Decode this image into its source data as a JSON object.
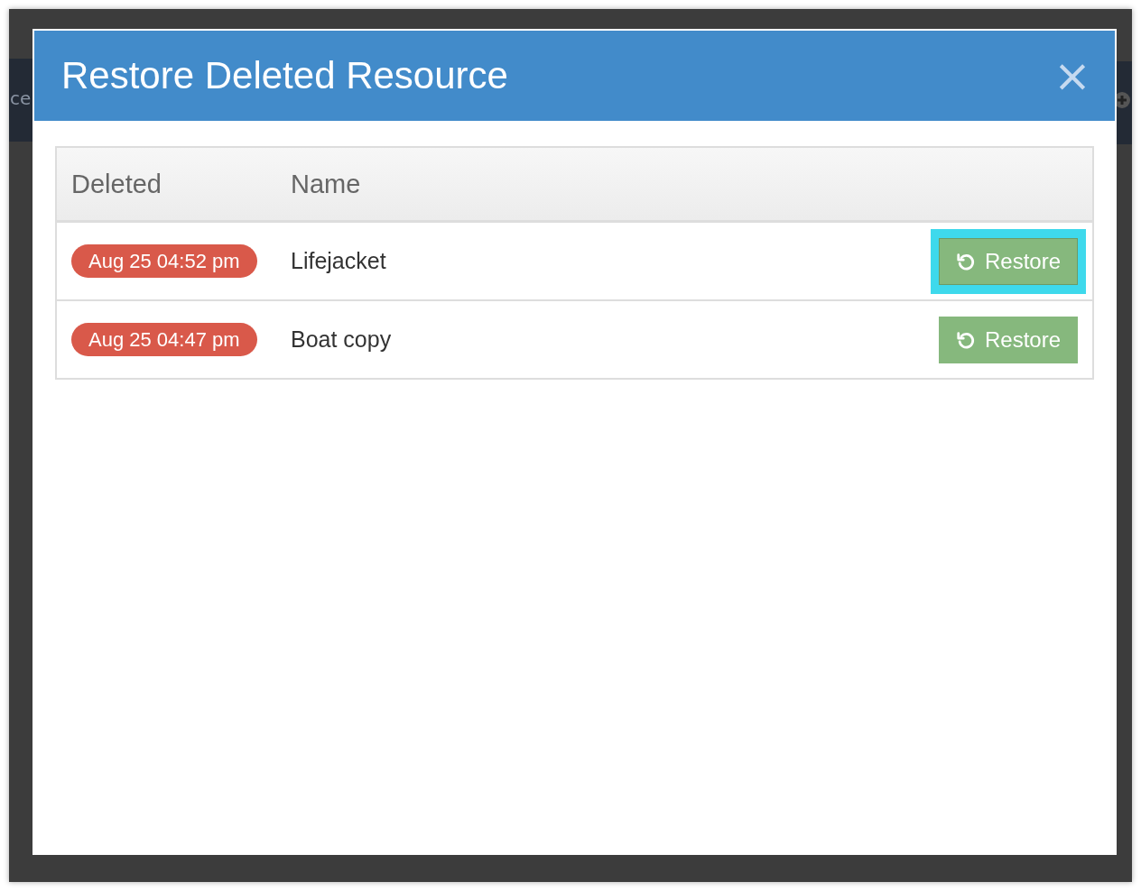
{
  "background": {
    "text_fragment": "ce"
  },
  "dialog": {
    "title": "Restore Deleted Resource",
    "close_label": "×"
  },
  "table": {
    "columns": [
      "Deleted",
      "Name"
    ],
    "rows": [
      {
        "deleted": "Aug 25 04:52 pm",
        "name": "Lifejacket",
        "action": "Restore",
        "focused": true
      },
      {
        "deleted": "Aug 25 04:47 pm",
        "name": "Boat copy",
        "action": "Restore",
        "focused": false
      }
    ]
  }
}
